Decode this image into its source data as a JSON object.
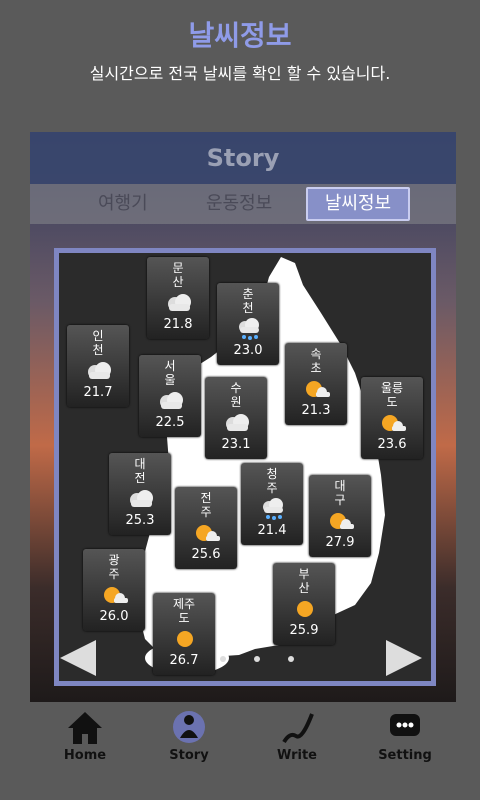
{
  "header": {
    "title": "날씨정보",
    "subtitle": "실시간으로 전국 날씨를 확인 할 수 있습니다."
  },
  "panel": {
    "title": "Story",
    "tabs": [
      {
        "label": "여행기",
        "active": false
      },
      {
        "label": "운동정보",
        "active": false
      },
      {
        "label": "날씨정보",
        "active": true
      }
    ]
  },
  "cities": [
    {
      "name": "문\n산",
      "temp": "21.8",
      "icon": "cloud-icon"
    },
    {
      "name": "춘\n천",
      "temp": "23.0",
      "icon": "snow-cloud-icon"
    },
    {
      "name": "인\n천",
      "temp": "21.7",
      "icon": "cloud-icon"
    },
    {
      "name": "서\n울",
      "temp": "22.5",
      "icon": "cloud-icon"
    },
    {
      "name": "속\n초",
      "temp": "21.3",
      "icon": "sun-cloud-icon"
    },
    {
      "name": "수\n원",
      "temp": "23.1",
      "icon": "cloud-icon"
    },
    {
      "name": "울릉\n도",
      "temp": "23.6",
      "icon": "sun-cloud-icon"
    },
    {
      "name": "대\n전",
      "temp": "25.3",
      "icon": "cloud-icon"
    },
    {
      "name": "청\n주",
      "temp": "21.4",
      "icon": "snow-cloud-icon"
    },
    {
      "name": "대\n구",
      "temp": "27.9",
      "icon": "sun-cloud-icon"
    },
    {
      "name": "전\n주",
      "temp": "25.6",
      "icon": "sun-cloud-icon"
    },
    {
      "name": "광\n주",
      "temp": "26.0",
      "icon": "sun-cloud-icon"
    },
    {
      "name": "제주\n도",
      "temp": "26.7",
      "icon": "sun-icon"
    },
    {
      "name": "부\n산",
      "temp": "25.9",
      "icon": "sun-icon"
    }
  ],
  "nav": [
    {
      "label": "Home",
      "icon": "home-icon"
    },
    {
      "label": "Story",
      "icon": "story-icon"
    },
    {
      "label": "Write",
      "icon": "pen-icon"
    },
    {
      "label": "Setting",
      "icon": "chat-bubble-icon"
    }
  ],
  "colors": {
    "accent": "#8f9be8",
    "frame": "#7f86c2",
    "active_tab": "#8790c8"
  }
}
